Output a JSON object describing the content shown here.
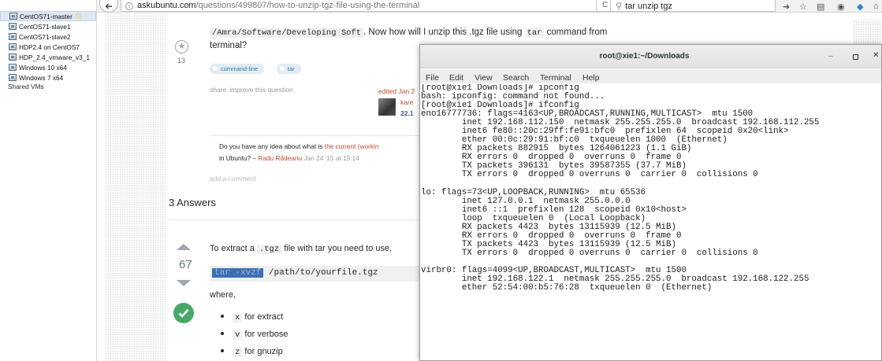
{
  "vm_library": {
    "items": [
      {
        "label": "CentOS71-master"
      },
      {
        "label": "CentOS71-slave1"
      },
      {
        "label": "CentOS71-slave2"
      },
      {
        "label": "HDP2.4 on CentOS7"
      },
      {
        "label": "HDP_2.4_vmware_v3_1"
      },
      {
        "label": "Windows 10 x64"
      },
      {
        "label": "Windows 7 x64"
      }
    ],
    "shared_label": "Shared VMs"
  },
  "browser": {
    "url_domain": "askubuntu.com",
    "url_path": "/questions/499807/how-to-unzip-tgz-file-using-the-terminal",
    "search_text": "tar unzip tgz",
    "reload_glyph": "C",
    "icons": [
      "back-icon",
      "info-icon",
      "reload-icon",
      "search-icon",
      "forward-icon",
      "bookmark-icon",
      "library-icon",
      "pocket-icon",
      "extension-icon",
      "home-icon"
    ]
  },
  "question": {
    "line1_code": "/Amra/Software/Developing Soft",
    "line1_mid": ". Now how will I unzip this .tgz file using ",
    "line1_code2": "tar",
    "line1_end": " command from",
    "line2": "terminal?",
    "favorite_count": "13",
    "tags": [
      "command-line",
      "tar"
    ],
    "share": "share",
    "improve": "improve this question",
    "edited": "edited Jan 2",
    "editor_name": "kare",
    "editor_rep": "22.1",
    "comment_prefix": "Do you have any idea about what is ",
    "comment_link": "the current (workin",
    "comment_line2_prefix": "in Ubuntu? – ",
    "comment_author": "Radu Rădeanu",
    "comment_date": " Jan 24 '15 at 19:14",
    "add_comment": "add a comment"
  },
  "answers": {
    "heading": "3 Answers",
    "vote_count": "67",
    "intro_prefix": "To extract a ",
    "intro_code": ".tgz",
    "intro_suffix": " file with tar you need to use,",
    "code_selected": "tar -xvzf",
    "code_rest": " /path/to/yourfile.tgz",
    "where": "where,",
    "bullets": [
      {
        "code": "x",
        "text": " for extract"
      },
      {
        "code": "v",
        "text": " for verbose"
      },
      {
        "code": "z",
        "text": " for gnuzip"
      }
    ]
  },
  "terminal": {
    "title": "root@xie1:~/Downloads",
    "menu": [
      "File",
      "Edit",
      "View",
      "Search",
      "Terminal",
      "Help"
    ],
    "lines": [
      "[root@xie1 Downloads]# ipconfig",
      "bash: ipconfig: command not found...",
      "[root@xie1 Downloads]# ifconfig",
      "eno16777736: flags=4163<UP,BROADCAST,RUNNING,MULTICAST>  mtu 1500",
      "        inet 192.168.112.150  netmask 255.255.255.0  broadcast 192.168.112.255",
      "        inet6 fe80::20c:29ff:fe91:bfc0  prefixlen 64  scopeid 0x20<link>",
      "        ether 00:0c:29:91:bf:c0  txqueuelen 1000  (Ethernet)",
      "        RX packets 882915  bytes 1264061223 (1.1 GiB)",
      "        RX errors 0  dropped 0  overruns 0  frame 0",
      "        TX packets 396131  bytes 39587355 (37.7 MiB)",
      "        TX errors 0  dropped 0 overruns 0  carrier 0  collisions 0",
      "",
      "lo: flags=73<UP,LOOPBACK,RUNNING>  mtu 65536",
      "        inet 127.0.0.1  netmask 255.0.0.0",
      "        inet6 ::1  prefixlen 128  scopeid 0x10<host>",
      "        loop  txqueuelen 0  (Local Loopback)",
      "        RX packets 4423  bytes 13115939 (12.5 MiB)",
      "        RX errors 0  dropped 0  overruns 0  frame 0",
      "        TX packets 4423  bytes 13115939 (12.5 MiB)",
      "        TX errors 0  dropped 0 overruns 0  carrier 0  collisions 0",
      "",
      "virbr0: flags=4099<UP,BROADCAST,MULTICAST>  mtu 1500",
      "        inet 192.168.122.1  netmask 255.255.255.0  broadcast 192.168.122.255",
      "        ether 52:54:00:b5:76:28  txqueuelen 0  (Ethernet)"
    ]
  },
  "colors": {
    "accent_link": "#c24c2a",
    "tag_bg": "#e1ecf4",
    "accepted": "#48a868",
    "selection": "#3d6fb4"
  }
}
